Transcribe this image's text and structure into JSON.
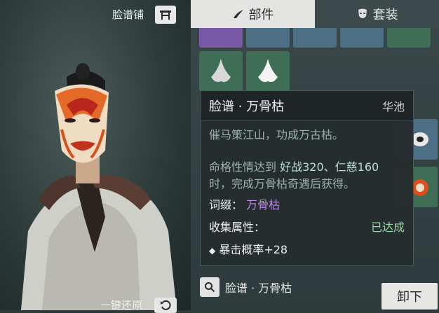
{
  "header": {
    "shop_label": "脸谱铺",
    "shop_icon": "shop-gate-icon"
  },
  "tabs": [
    {
      "label": "部件",
      "icon": "brush-icon",
      "active": true
    },
    {
      "label": "套装",
      "icon": "mask-icon",
      "active": false
    }
  ],
  "tooltip": {
    "title": "脸谱 · 万骨枯",
    "origin": "华池",
    "flavor": "催马策江山，功成万古枯。",
    "condition_prefix": "命格性情达到",
    "condition_values": "好战320、仁慈160",
    "condition_suffix": "时，完成万骨枯奇遇后获得。",
    "affix_label": "词缀：",
    "affix_value": "万骨枯",
    "collection_label": "收集属性：",
    "collection_status": "已达成",
    "bonus_bullet": "◆",
    "bonus": "暴击概率+28"
  },
  "search": {
    "text": "脸谱 · 万骨枯"
  },
  "footer": {
    "restore_label": "一键还原",
    "unload_label": "卸下"
  },
  "colors": {
    "active_tab_bg": "#e4e4e2",
    "affix_purple": "#c28cf0",
    "status_green": "#9ad7a8",
    "tile_green": "#3f6e56"
  }
}
